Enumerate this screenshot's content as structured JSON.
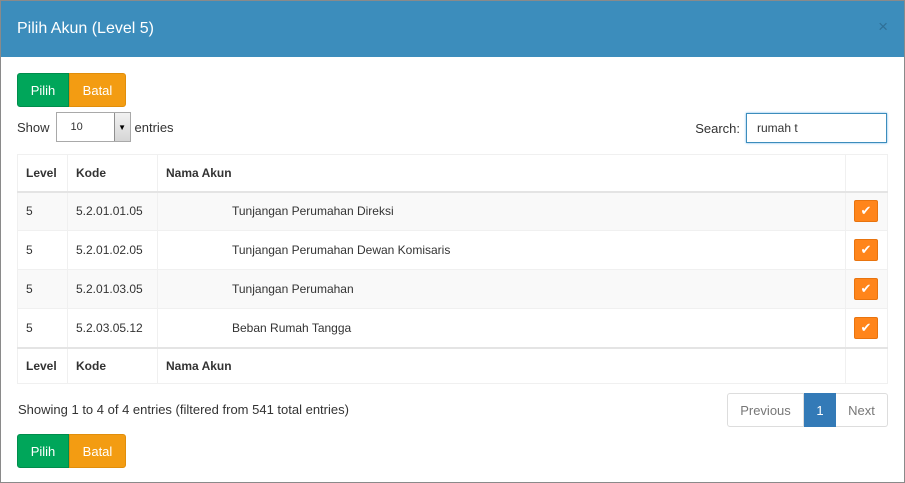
{
  "modal": {
    "title": "Pilih Akun (Level 5)",
    "close_label": "×"
  },
  "actions": {
    "pilih_label": "Pilih",
    "batal_label": "Batal"
  },
  "length_menu": {
    "show_label": "Show",
    "selected": "10",
    "entries_label": "entries"
  },
  "search": {
    "label": "Search:",
    "value": "rumah t"
  },
  "table": {
    "headers": {
      "level": "Level",
      "kode": "Kode",
      "nama": "Nama Akun"
    },
    "rows": [
      {
        "level": "5",
        "kode": "5.2.01.01.05",
        "nama": "Tunjangan Perumahan Direksi"
      },
      {
        "level": "5",
        "kode": "5.2.01.02.05",
        "nama": "Tunjangan Perumahan Dewan Komisaris"
      },
      {
        "level": "5",
        "kode": "5.2.01.03.05",
        "nama": "Tunjangan Perumahan"
      },
      {
        "level": "5",
        "kode": "5.2.03.05.12",
        "nama": "Beban Rumah Tangga"
      }
    ]
  },
  "info_text": "Showing 1 to 4 of 4 entries (filtered from 541 total entries)",
  "pagination": {
    "previous": "Previous",
    "current": "1",
    "next": "Next"
  },
  "icons": {
    "row_action": "check-icon"
  },
  "colors": {
    "header_bg": "#3c8dbc",
    "pilih_bg": "#00a65a",
    "batal_bg": "#f39c12",
    "check_bg": "#ff851b",
    "active_page": "#337ab7"
  }
}
